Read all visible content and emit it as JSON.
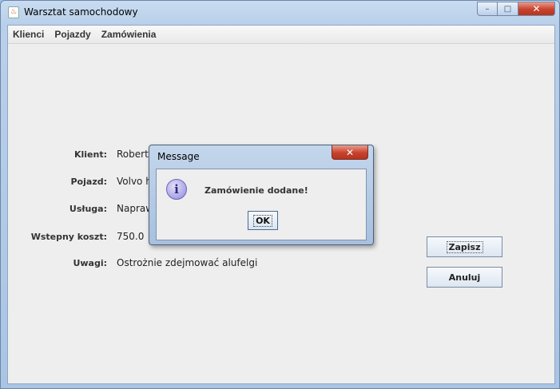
{
  "window": {
    "title": "Warsztat samochodowy",
    "buttons": {
      "minimize": "–",
      "maximize": "□",
      "close": "✕"
    }
  },
  "menu": {
    "items": [
      "Klienci",
      "Pojazdy",
      "Zamówienia"
    ]
  },
  "form": {
    "client_label": "Klient:",
    "client_value": "Robert K",
    "vehicle_label": "Pojazd:",
    "vehicle_value": "Volvo ha",
    "service_label": "Usługa:",
    "service_value": "Napraw",
    "cost_label": "Wstepny koszt:",
    "cost_value": "750.0",
    "notes_label": "Uwagi:",
    "notes_value": "Ostrożnie zdejmować alufelgi",
    "save_label": "Zapisz",
    "cancel_label": "Anuluj"
  },
  "dialog": {
    "title": "Message",
    "close_glyph": "✕",
    "icon_glyph": "i",
    "message": "Zamówienie dodane!",
    "ok_label": "OK"
  },
  "icons": {
    "app": "java-icon",
    "dialog": "info-icon"
  }
}
